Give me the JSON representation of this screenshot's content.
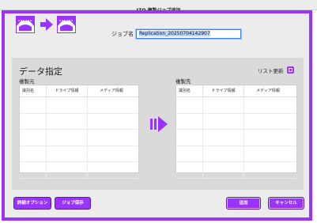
{
  "window": {
    "title": "LTO 複製ジョブ追加"
  },
  "job": {
    "label": "ジョブ名",
    "value": "Replication_20250704142907"
  },
  "data_section": {
    "title": "データ指定",
    "list_update_label": "リスト更新",
    "source": {
      "label": "複製元",
      "columns": [
        "識別名",
        "ドライブ情報",
        "メディア情報"
      ]
    },
    "destination": {
      "label": "複製先",
      "columns": [
        "識別名",
        "ドライブ情報",
        "メディア情報"
      ]
    }
  },
  "buttons": {
    "detail_options": "詳細オプション",
    "save_job": "ジョブ保存",
    "add": "追加",
    "cancel": "キャンセル"
  },
  "colors": {
    "accent": "#9933ff",
    "panel": "#dadada",
    "window": "#ececec"
  }
}
